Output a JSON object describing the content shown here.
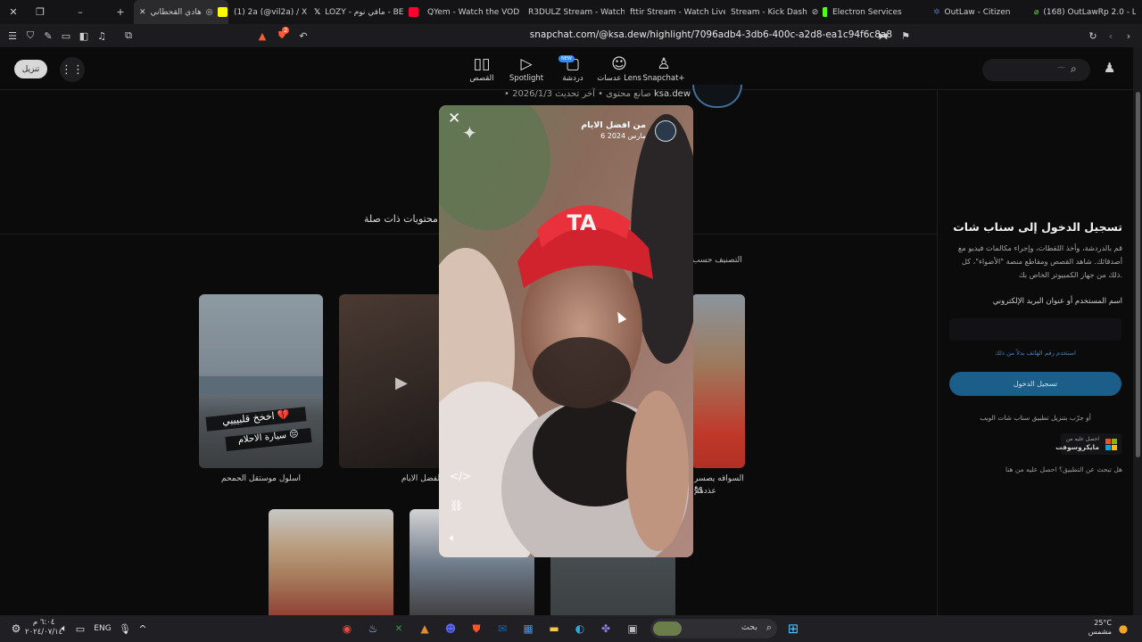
{
  "browser": {
    "tabs": [
      {
        "label": "هادي القحطاني",
        "active": true,
        "favicon_color": "#fffc00"
      },
      {
        "label": "(1) 2a (@vil2a) / X",
        "active": false,
        "favicon_color": "#e7e7e7"
      },
      {
        "label": "LOZY - مافي نوم - BE",
        "active": false,
        "favicon_color": "#ff0033"
      },
      {
        "label": "QYem - Watch the VOD",
        "active": false,
        "favicon_color": "#53fc18"
      },
      {
        "label": "R3DULZ Stream - Watch",
        "active": false,
        "favicon_color": "#53fc18"
      },
      {
        "label": "fttir Stream - Watch Live",
        "active": false,
        "favicon_color": "#53fc18"
      },
      {
        "label": "Stream - Kick Dash",
        "active": false,
        "favicon_color": "#53fc18"
      },
      {
        "label": "Electron Services",
        "active": false,
        "favicon_color": "#53fc18"
      },
      {
        "label": "OutLaw - Citizen",
        "active": false,
        "favicon_color": "#4a6fa5"
      },
      {
        "label": "(168) OutLawRp 2.0 - L",
        "active": false,
        "favicon_color": "#5865f2"
      }
    ],
    "url": "snapchat.com/@ksa.dew/highlight/7096adb4-3db6-400c-a2d8-ea1c94f6c8a8",
    "extension_badge": "2"
  },
  "topnav": {
    "download_label": "تنزيل",
    "items": [
      {
        "label": "القصص",
        "icon": "stories-icon"
      },
      {
        "label": "Spotlight",
        "icon": "play-icon"
      },
      {
        "label": "دردشة",
        "icon": "chat-icon",
        "badge": "NEW"
      },
      {
        "label": "عدسات Lens",
        "icon": "lens-icon"
      },
      {
        "label": "Snapchat+",
        "icon": "ghost-plus-icon"
      }
    ],
    "search_placeholder": "—"
  },
  "profile": {
    "username": "ksa.dew",
    "meta": "• صانع محتوى • آخر تحديث 2026/1/3"
  },
  "related": {
    "title": "محتويات ذات صلة",
    "sort_label": "التصنيف حسب",
    "cards": [
      {
        "caption": "اسلول موستقل الحمحم",
        "overlay_line1": "اخخخ قلبيييي 💔",
        "overlay_line2": "سيارة الاحلام 😔"
      },
      {
        "caption": "من الفضل الايام"
      },
      {
        "caption_line1": "السواقه يصسر مع",
        "caption_line2": "عذدهم"
      },
      {
        "caption": ""
      },
      {
        "caption": ""
      },
      {
        "caption": ""
      }
    ]
  },
  "viewer": {
    "title": "من افضل الايام",
    "date": "6 مارس 2024",
    "close_label": "✕",
    "actions": [
      "embed-icon",
      "link-icon",
      "volume-icon"
    ]
  },
  "login": {
    "heading": "تسجيل الدخول إلى سناب شات",
    "description": "قم بالدردشة، وأخذ اللقطات، وإجراء مكالمات فيديو مع أصدقائك. شاهد القصص ومقاطع منصة \"الأضواء\"، كل ذلك من جهاز الكمبيوتر الخاص بك.",
    "field_label": "اسم المستخدم أو عنوان البريد الإلكتروني",
    "phone_link": "استخدم رقم الهاتف بدلاً من ذلك",
    "submit_label": "تسجيل الدخول",
    "download_text": "أو جرّب بتنزيل تطبيق سناب شات الويب",
    "ms_line1": "احصل عليه من",
    "ms_line2": "مايكروسوفت",
    "help_text": "هل تبحث عن التطبيق؟ احصل عليه من هنا"
  },
  "taskbar": {
    "search_label": "بحث",
    "language": "ENG",
    "time": "٦:٠٤ م",
    "date": "٢٠٢٤/٠٧/١٤",
    "weather_temp": "25°C",
    "weather_desc": "مشمس"
  }
}
